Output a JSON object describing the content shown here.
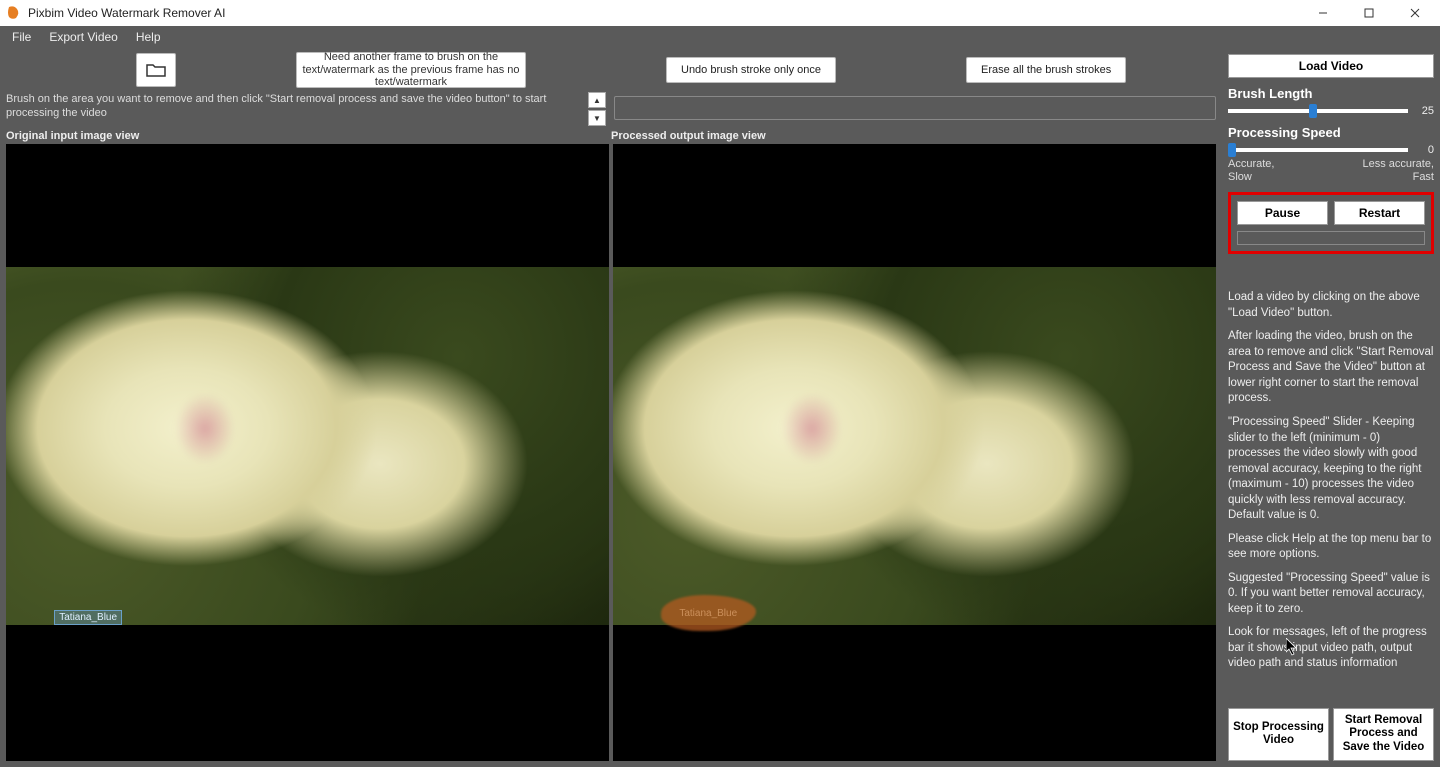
{
  "app": {
    "title": "Pixbim Video Watermark Remover AI"
  },
  "menu": {
    "file": "File",
    "export": "Export Video",
    "help": "Help"
  },
  "toolbar": {
    "need_frame": "Need another frame to brush on the text/watermark as the previous frame has no text/watermark",
    "undo": "Undo brush stroke only once",
    "erase": "Erase all the brush strokes"
  },
  "hint": "Brush on the area you want to remove and then click \"Start removal process and save the video button\" to start processing the video",
  "views": {
    "input_label": "Original input image view",
    "output_label": "Processed output image view",
    "watermark_text": "Tatiana_Blue"
  },
  "right": {
    "load_video": "Load Video",
    "brush_length_label": "Brush Length",
    "brush_length_value": "25",
    "brush_length_pct": 45,
    "proc_speed_label": "Processing Speed",
    "proc_speed_value": "0",
    "proc_speed_pct": 0,
    "accurate": "Accurate,",
    "slow": "Slow",
    "less_accurate": "Less accurate,",
    "fast": "Fast",
    "pause": "Pause",
    "restart": "Restart",
    "info_p1": "Load a video by clicking on the above \"Load Video\" button.",
    "info_p2": "After loading the video, brush on the area to remove and click \"Start Removal Process and Save the Video\" button at lower right corner to start the removal process.",
    "info_p3": "\"Processing Speed\" Slider - Keeping slider to the left (minimum - 0) processes the video slowly with good removal accuracy, keeping to the right (maximum - 10) processes the video quickly with less removal accuracy. Default value is 0.",
    "info_p4": "Please click Help at the top menu bar to see more options.",
    "info_p5": "Suggested \"Processing Speed\" value is 0. If you want better removal accuracy, keep it to zero.",
    "info_p6": "Look for messages, left of the progress bar it shows input video path, output video path and status information",
    "stop": "Stop Processing Video",
    "start": "Start Removal Process and Save the Video"
  }
}
